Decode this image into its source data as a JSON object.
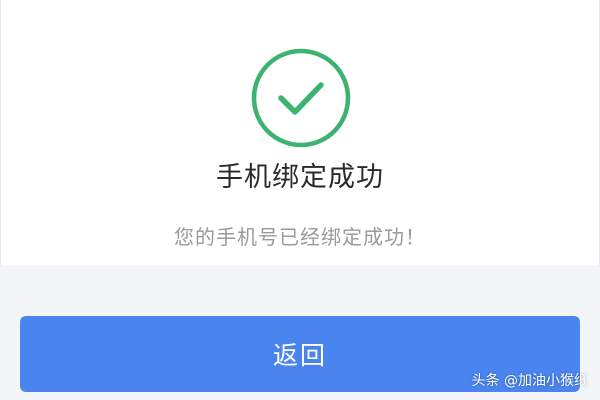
{
  "success": {
    "icon": "checkmark-circle-icon",
    "title": "手机绑定成功",
    "message": "您的手机号已经绑定成功！"
  },
  "actions": {
    "back_label": "返回"
  },
  "watermark": {
    "text": "头条 @加油小猴纸"
  },
  "colors": {
    "success_green": "#3cb371",
    "button_blue": "#4a84ef",
    "background": "#f4f5f9",
    "card": "#ffffff"
  }
}
